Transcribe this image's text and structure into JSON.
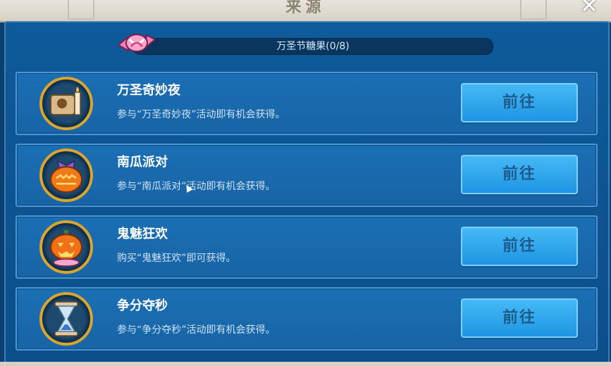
{
  "window": {
    "title": "来源",
    "close_label": "✕"
  },
  "progress": {
    "label": "万圣节糖果(0/8)",
    "current": 0,
    "total": 8
  },
  "sources": [
    {
      "name": "万圣奇妙夜",
      "desc": "参与“万圣奇妙夜”活动即有机会获得。",
      "button": "前往",
      "icon": "scroll-candle-icon"
    },
    {
      "name": "南瓜派对",
      "desc": "参与“南瓜派对”活动即有机会获得。",
      "button": "前往",
      "icon": "pumpkin-gift-icon"
    },
    {
      "name": "鬼魅狂欢",
      "desc": "购买“鬼魅狂欢”即可获得。",
      "button": "前往",
      "icon": "jack-o-lantern-icon"
    },
    {
      "name": "争分夺秒",
      "desc": "参与“争分夺秒”活动即有机会获得。",
      "button": "前往",
      "icon": "hourglass-icon"
    }
  ]
}
